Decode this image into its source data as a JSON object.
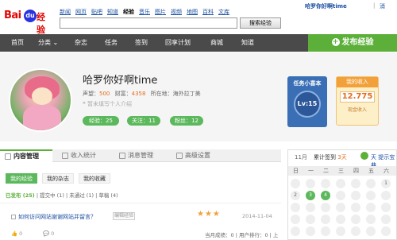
{
  "header": {
    "logo_bai": "Bai",
    "logo_paw": "du",
    "logo_jingyan": "经验",
    "nav_links": [
      "新闻",
      "网页",
      "贴吧",
      "知道",
      "经验",
      "音乐",
      "图片",
      "视频",
      "地图",
      "百科",
      "文库"
    ],
    "active_nav": "经验",
    "search_value": "",
    "search_button": "搜索经验",
    "user_name": "哈罗你好啊time",
    "user_sep": "|",
    "messages": "消"
  },
  "navbar": {
    "items": [
      "首页",
      "分类",
      "杂志",
      "任务",
      "签到",
      "回享计划",
      "商城",
      "知道"
    ],
    "publish": "发布经验"
  },
  "profile": {
    "username": "哈罗你好啊time",
    "prestige_label": "声望：",
    "prestige": "500",
    "wealth_label": "财富：",
    "wealth": "4358",
    "location_label": "所在地：",
    "location": "海外拉丁美",
    "intro": "暂未填写个人介绍",
    "pills": [
      "经验：25",
      "关注：11",
      "粉丝：12"
    ]
  },
  "task_card": {
    "title": "任务小喜本",
    "level": "Lv:15"
  },
  "income_card": {
    "title": "我的收入",
    "value": "12.775",
    "unit": "现金收入"
  },
  "tabs": [
    "内容管理",
    "收入统计",
    "消息管理",
    "高级设置"
  ],
  "subtabs": [
    "我的经验",
    "我的杂志",
    "我的收藏"
  ],
  "filter": {
    "published": "已发布",
    "published_count": "(25)",
    "draft": "草稿(4)",
    "items": [
      "提交中 (1)",
      "未通过 (1)",
      "草稿 (4)"
    ]
  },
  "posts": [
    {
      "title": "如何访问网站谢谢网站并留言？",
      "edit": "编辑经验",
      "stars": "★★★",
      "date": "2014-11-04",
      "likes": "0",
      "comments": "0"
    }
  ],
  "pager": "当月成绩：0 | 用户排行：0 | 上",
  "calendar": {
    "month": "11月",
    "signed_label": "累计签到",
    "signed_days": "3天",
    "forecast": "天 提示宝典",
    "weekdays": [
      "日",
      "一",
      "二",
      "三",
      "四",
      "五",
      "六"
    ],
    "rows": [
      [
        "",
        "",
        "",
        "",
        "",
        "",
        "1"
      ],
      [
        "2",
        "3",
        "4",
        "",
        "",
        "",
        ""
      ],
      [
        "",
        "",
        "",
        "",
        "",
        "",
        ""
      ],
      [
        "",
        "",
        "",
        "",
        "",
        "",
        ""
      ],
      [
        "",
        "",
        "",
        "",
        "",
        "",
        ""
      ]
    ],
    "signed": [
      "3",
      "4"
    ]
  }
}
